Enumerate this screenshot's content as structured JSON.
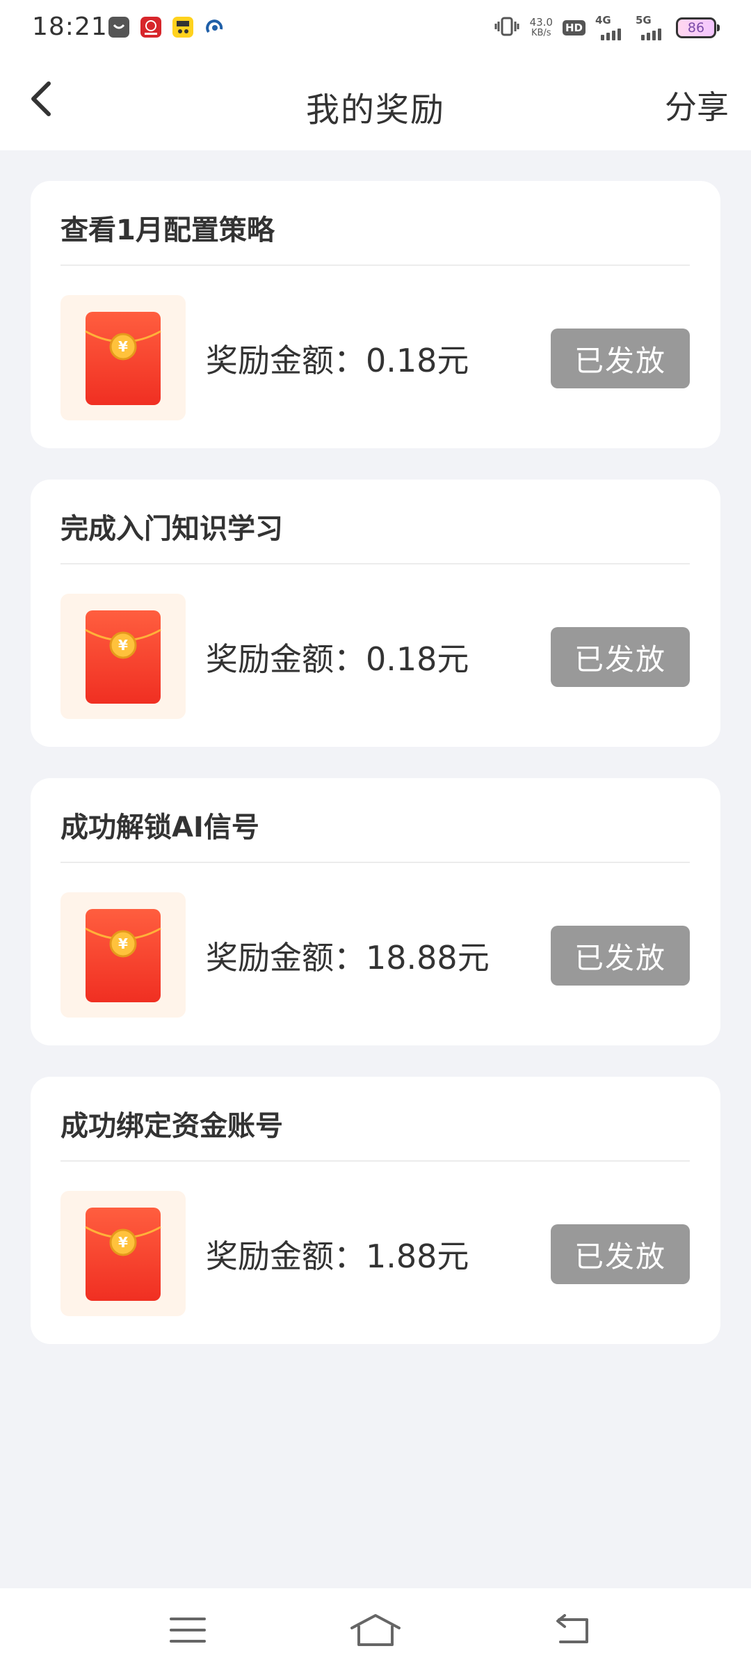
{
  "status_bar": {
    "time": "18:21",
    "network_speed_value": "43.0",
    "network_speed_unit": "KB/s",
    "hd_label": "HD",
    "sim1_label": "4G",
    "sim2_label": "5G",
    "battery_level": "86"
  },
  "header": {
    "title": "我的奖励",
    "share_label": "分享"
  },
  "colors": {
    "background": "#f2f3f7",
    "card": "#ffffff",
    "envelope_red": "#f5452a",
    "envelope_gold": "#ffc23c",
    "button_disabled": "#999999"
  },
  "rewards": [
    {
      "title": "查看1月配置策略",
      "amount_label": "奖励金额：0.18元",
      "status": "已发放"
    },
    {
      "title": "完成入门知识学习",
      "amount_label": "奖励金额：0.18元",
      "status": "已发放"
    },
    {
      "title": "成功解锁AI信号",
      "amount_label": "奖励金额：18.88元",
      "status": "已发放"
    },
    {
      "title": "成功绑定资金账号",
      "amount_label": "奖励金额：1.88元",
      "status": "已发放"
    }
  ],
  "icons": {
    "back": "chevron-left-icon",
    "envelope": "red-envelope-icon",
    "menu": "menu-icon",
    "home": "home-icon",
    "return": "back-arrow-icon"
  }
}
